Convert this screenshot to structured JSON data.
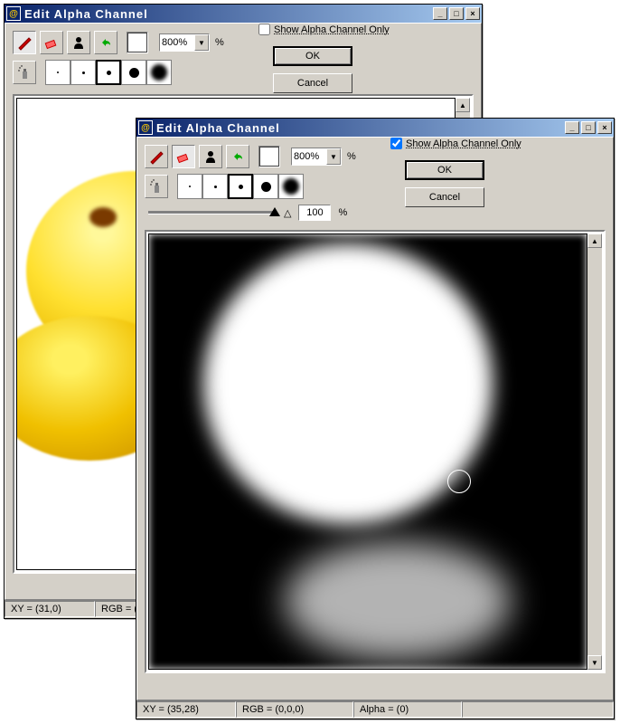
{
  "windowBack": {
    "title": "Edit Alpha Channel",
    "zoom": "800%",
    "zoomUnit": "%",
    "showAlphaOnly": false,
    "showAlphaLabel": "Show Alpha Channel Only",
    "okLabel": "OK",
    "cancelLabel": "Cancel",
    "status": {
      "xy": "XY = (31,0)",
      "rgb": "RGB = ("
    }
  },
  "windowFront": {
    "title": "Edit Alpha Channel",
    "zoom": "800%",
    "zoomUnit": "%",
    "showAlphaOnly": true,
    "showAlphaLabel": "Show Alpha Channel Only",
    "okLabel": "OK",
    "cancelLabel": "Cancel",
    "opacityValue": "100",
    "opacityUnit": "%",
    "status": {
      "xy": "XY = (35,28)",
      "rgb": "RGB = (0,0,0)",
      "alpha": "Alpha = (0)"
    }
  },
  "icons": {
    "brush": "brush-icon",
    "eraser": "eraser-icon",
    "fill": "fill-icon",
    "undo": "undo-icon",
    "spray": "spray-icon"
  }
}
